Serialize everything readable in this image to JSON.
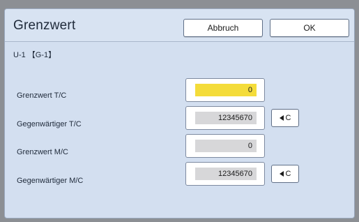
{
  "dialog": {
    "title": "Grenzwert",
    "cancel_label": "Abbruch",
    "ok_label": "OK",
    "subtitle": "U-1 【G-1】"
  },
  "rows": [
    {
      "label": "Grenzwert T/C",
      "value": "0",
      "active": true
    },
    {
      "label": "Gegenwärtiger T/C",
      "value": "12345670",
      "clear_label": "C"
    },
    {
      "label": "Grenzwert M/C",
      "value": "0"
    },
    {
      "label": "Gegenwärtiger M/C",
      "value": "12345670",
      "clear_label": "C"
    }
  ],
  "colors": {
    "active_field": "#f4dc3a",
    "panel_bg": "#d3dff0"
  },
  "icons": {
    "clear": "arrow-left-icon"
  }
}
